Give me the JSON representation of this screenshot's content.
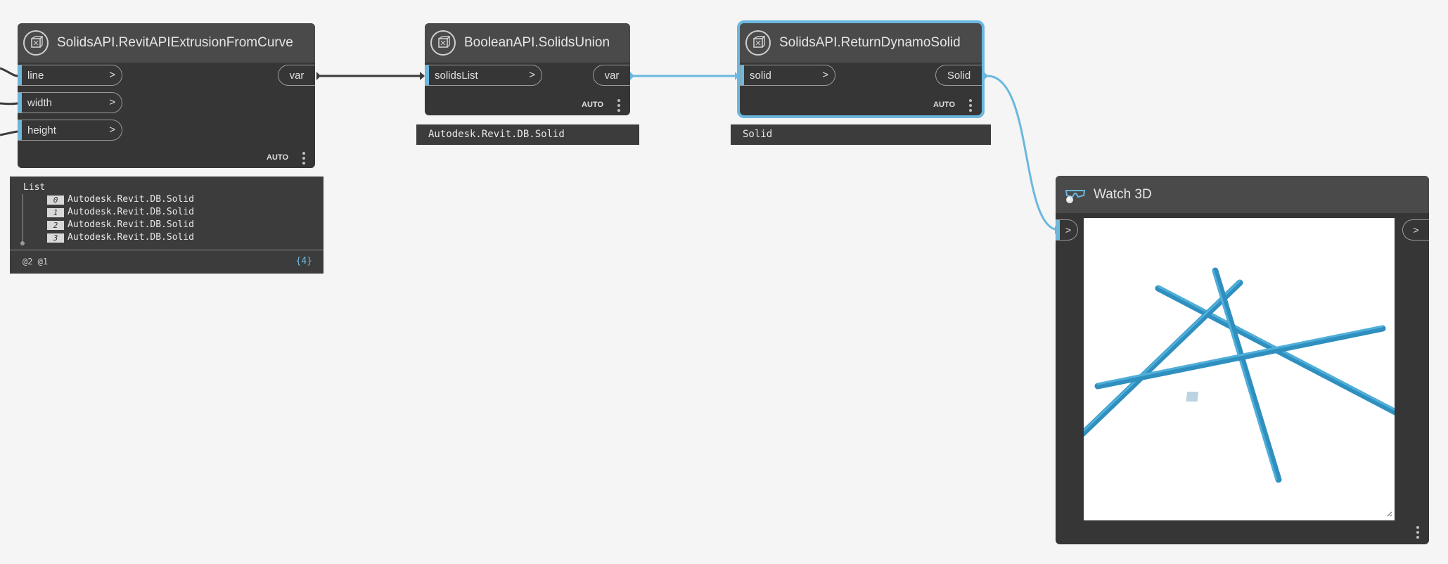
{
  "colors": {
    "canvas": "#f5f5f5",
    "node_body": "#363636",
    "node_header": "#4a4a4a",
    "wire_default": "#3a3a3a",
    "wire_selected": "#6ab8e0",
    "port_accent": "#6ab8e0",
    "geometry": "#2e93c4"
  },
  "nodes": {
    "extrusion": {
      "title": "SolidsAPI.RevitAPIExtrusionFromCurve",
      "icon": "revit-api-node-icon",
      "inputs": [
        {
          "label": "line",
          "chevron": ">"
        },
        {
          "label": "width",
          "chevron": ">"
        },
        {
          "label": "height",
          "chevron": ">"
        }
      ],
      "output": "var",
      "lacing": "AUTO",
      "preview": {
        "header": "List",
        "items": [
          {
            "index": "0",
            "value": "Autodesk.Revit.DB.Solid"
          },
          {
            "index": "1",
            "value": "Autodesk.Revit.DB.Solid"
          },
          {
            "index": "2",
            "value": "Autodesk.Revit.DB.Solid"
          },
          {
            "index": "3",
            "value": "Autodesk.Revit.DB.Solid"
          }
        ],
        "levels": "@2 @1",
        "count": "{4}"
      }
    },
    "union": {
      "title": "BooleanAPI.SolidsUnion",
      "icon": "revit-api-node-icon",
      "inputs": [
        {
          "label": "solidsList",
          "chevron": ">"
        }
      ],
      "output": "var",
      "lacing": "AUTO",
      "preview": "Autodesk.Revit.DB.Solid"
    },
    "return_solid": {
      "title": "SolidsAPI.ReturnDynamoSolid",
      "icon": "revit-api-node-icon",
      "inputs": [
        {
          "label": "solid",
          "chevron": ">"
        }
      ],
      "output": "Solid",
      "lacing": "AUTO",
      "preview": "Solid",
      "selected": true
    },
    "watch3d": {
      "title": "Watch 3D",
      "icon": "watch-3d-glasses-icon",
      "input_chevron": ">",
      "output_chevron": ">"
    }
  }
}
